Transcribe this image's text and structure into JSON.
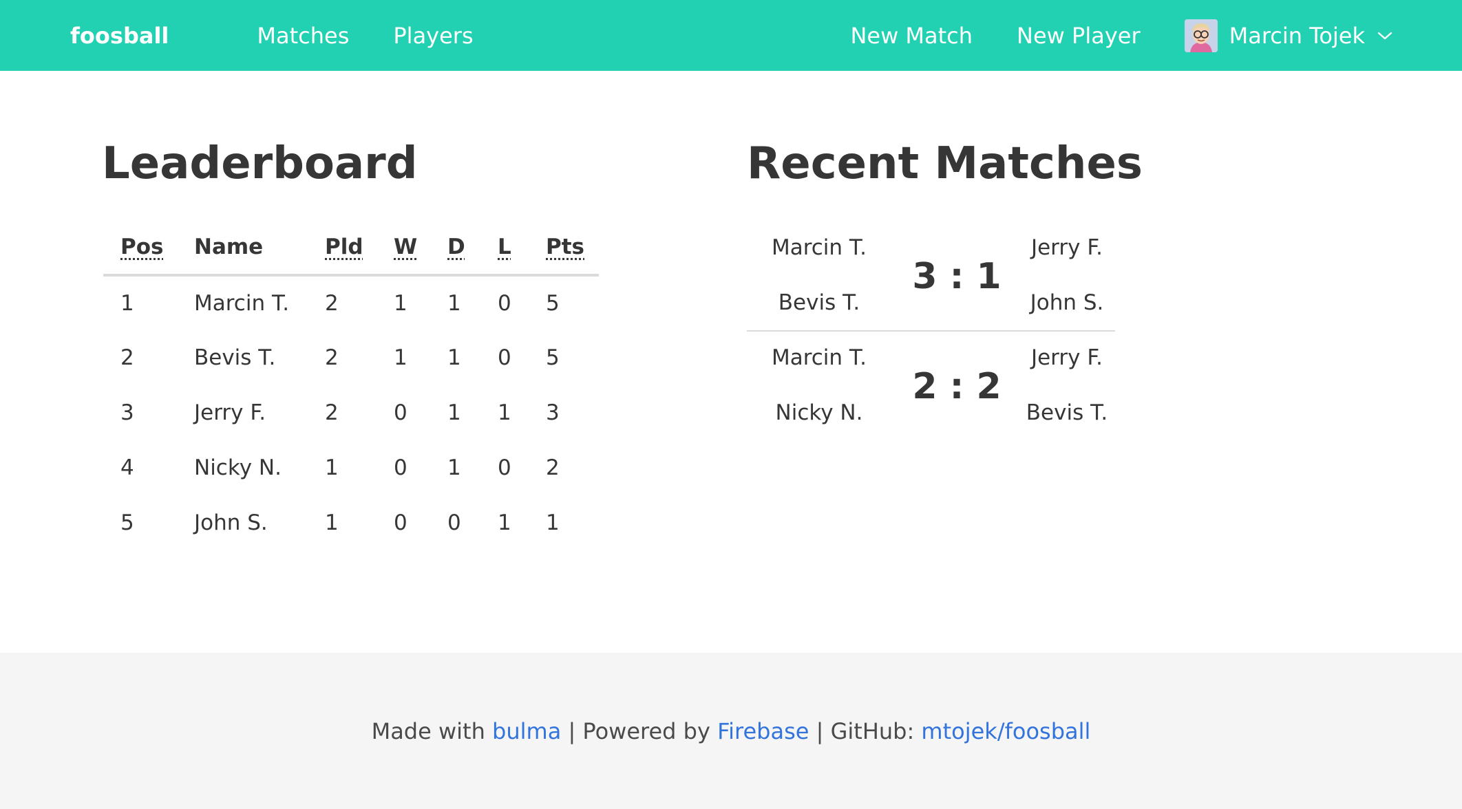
{
  "nav": {
    "brand": "foosball",
    "links": [
      "Matches",
      "Players"
    ],
    "actions": [
      "New Match",
      "New Player"
    ],
    "user_name": "Marcin Tojek",
    "avatar_icon": "avatar-icon",
    "dropdown_icon": "chevron-down-icon",
    "color": "#22d1b2"
  },
  "leaderboard": {
    "title": "Leaderboard",
    "headers": {
      "pos": "Pos",
      "name": "Name",
      "pld": "Pld",
      "w": "W",
      "d": "D",
      "l": "L",
      "pts": "Pts"
    },
    "rows": [
      {
        "pos": "1",
        "name": "Marcin T.",
        "pld": "2",
        "w": "1",
        "d": "1",
        "l": "0",
        "pts": "5"
      },
      {
        "pos": "2",
        "name": "Bevis T.",
        "pld": "2",
        "w": "1",
        "d": "1",
        "l": "0",
        "pts": "5"
      },
      {
        "pos": "3",
        "name": "Jerry F.",
        "pld": "2",
        "w": "0",
        "d": "1",
        "l": "1",
        "pts": "3"
      },
      {
        "pos": "4",
        "name": "Nicky N.",
        "pld": "1",
        "w": "0",
        "d": "1",
        "l": "0",
        "pts": "2"
      },
      {
        "pos": "5",
        "name": "John S.",
        "pld": "1",
        "w": "0",
        "d": "0",
        "l": "1",
        "pts": "1"
      }
    ]
  },
  "recent": {
    "title": "Recent Matches",
    "matches": [
      {
        "left": [
          "Marcin T.",
          "Bevis T."
        ],
        "score": "3 : 1",
        "right": [
          "Jerry F.",
          "John S."
        ]
      },
      {
        "left": [
          "Marcin T.",
          "Nicky N."
        ],
        "score": "2 : 2",
        "right": [
          "Jerry F.",
          "Bevis T."
        ]
      }
    ]
  },
  "footer": {
    "made_with": "Made with",
    "bulma": "bulma",
    "sep1": "| Powered by",
    "firebase": "Firebase",
    "sep2": "| GitHub:",
    "github": "mtojek/foosball",
    "link_color": "#3273dc"
  }
}
